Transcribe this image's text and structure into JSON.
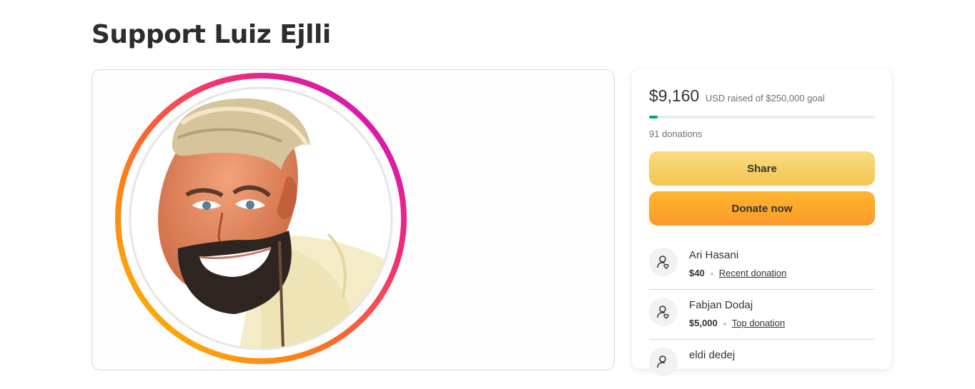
{
  "page": {
    "title": "Support Luiz Ejlli"
  },
  "fundraiser": {
    "raised": "$9,160",
    "raised_caption": "USD raised of $250,000 goal",
    "progress_fraction": 0.037,
    "donations": "91 donations"
  },
  "actions": {
    "share_label": "Share",
    "donate_label": "Donate now"
  },
  "donors": [
    {
      "name": "Ari Hasani",
      "amount": "$40",
      "tag": "Recent donation"
    },
    {
      "name": "Fabjan Dodaj",
      "amount": "$5,000",
      "tag": "Top donation"
    },
    {
      "name": "eldi dedej"
    }
  ],
  "colors": {
    "progress": "#02a95c",
    "share_button": "#f6ce60",
    "donate_button": "#fda72d",
    "ring_gradient": [
      "#f7c600",
      "#ff7a1a",
      "#ee2a7b",
      "#c70bd6"
    ]
  },
  "icons": {
    "donor_avatar": "user-heart-icon"
  }
}
